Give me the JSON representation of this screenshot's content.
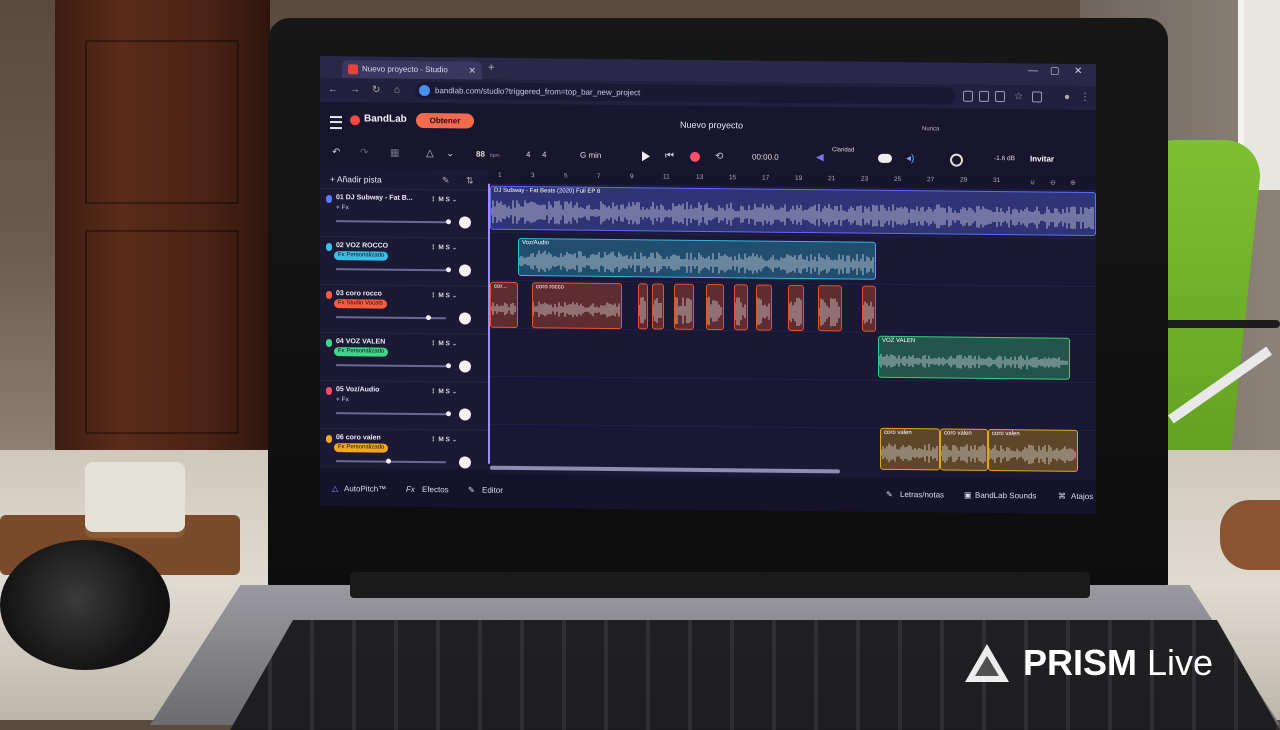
{
  "browser": {
    "tab_title": "Nuevo proyecto - Studio",
    "new_tab": "+",
    "url": "bandlab.com/studio?triggered_from=top_bar_new_project"
  },
  "app": {
    "logo": "BandLab",
    "obtener": "Obtener",
    "project_title": "Nuevo proyecto",
    "nunca": "Nunca"
  },
  "transport": {
    "bpm": "88",
    "bpm_unit": "bpm",
    "sig_top": "4",
    "sig_bottom": "4",
    "key": "G min",
    "time": "00:00.0",
    "claridad": "Claridad",
    "master_db": "-1.6 dB",
    "invitar": "Invitar"
  },
  "sidebar": {
    "add_track": "Añadir pista",
    "tracks": [
      {
        "name": "01  DJ Subway - Fat B...",
        "fx": "+ Fx",
        "color": "#5b7cff",
        "pill": ""
      },
      {
        "name": "02  VOZ ROCCO",
        "fx": "",
        "color": "#39c0e8",
        "pill": "Fx Personalizado"
      },
      {
        "name": "03  coro rocco",
        "fx": "",
        "color": "#ff5a3c",
        "pill": "Fx Studio Vocals"
      },
      {
        "name": "04  VOZ VALEN",
        "fx": "",
        "color": "#3fd68a",
        "pill": "Fx Personalizado"
      },
      {
        "name": "05  Voz/Audio",
        "fx": "+ Fx",
        "color": "#ff4a6a",
        "pill": ""
      },
      {
        "name": "06  coro valen",
        "fx": "",
        "color": "#f2a818",
        "pill": "Fx Personalizado"
      }
    ],
    "mute": "M",
    "solo": "S"
  },
  "ruler": {
    "marks": [
      "1",
      "3",
      "5",
      "7",
      "9",
      "11",
      "13",
      "15",
      "17",
      "19",
      "21",
      "23",
      "25",
      "27",
      "29",
      "31"
    ]
  },
  "regions": {
    "beat": "DJ Subway - Fat Beats (2020) Full EP 8",
    "voz_audio": "Voz/Audio",
    "coro_short": "cor...",
    "coro_rocco": "coro rocco",
    "voz_valen": "VOZ VALEN",
    "coro_valen_1": "coro valen",
    "coro_valen_2": "coro valen",
    "coro_valen_3": "coro valen"
  },
  "footer": {
    "autopitch": "AutoPitch™",
    "efectos": "Efectos",
    "editor": "Editor",
    "letras": "Letras/notas",
    "sounds": "BandLab Sounds",
    "atajos": "Atajos"
  },
  "watermark": {
    "brand": "PRISM",
    "live": "Live"
  },
  "colors": {
    "beat": "#5b6cff",
    "voz_rocco": "#2fb6e6",
    "coro_rocco": "#e8532e",
    "voz_valen": "#35d07a",
    "coro_valen": "#e6a21a",
    "accent": "#f26b4e"
  }
}
